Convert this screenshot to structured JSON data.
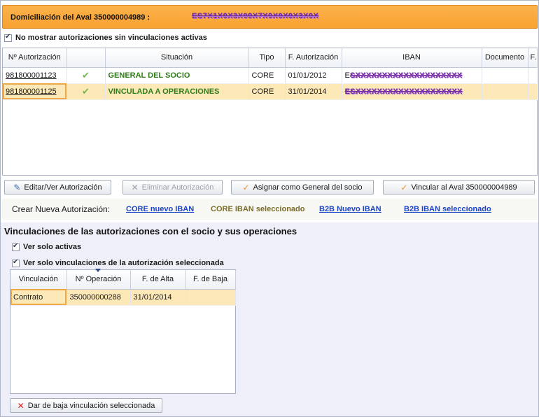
{
  "header": {
    "title": "Domiciliación del Aval 350000004989 :",
    "masked_value": "ES7X1X0X3X09X7X0X0X0X3X0X"
  },
  "filter_no_active": {
    "label": "No mostrar autorizaciones sin vinculaciones activas",
    "checked": true
  },
  "auth_table": {
    "columns": [
      "Nº Autorización",
      "",
      "Situación",
      "Tipo",
      "F. Autorización",
      "IBAN",
      "Documento",
      "F."
    ],
    "rows": [
      {
        "numero": "981800001123",
        "estado_icon": "check-icon",
        "situacion": "GENERAL DEL SOCIO",
        "tipo": "CORE",
        "fecha": "01/01/2012",
        "iban_prefix": "E",
        "iban_masked": "SXXXXXXXXXXXXXXXXXXXX",
        "documento": "",
        "extra": ""
      },
      {
        "numero": "981800001125",
        "estado_icon": "check-icon",
        "situacion": "VINCULADA A OPERACIONES",
        "tipo": "CORE",
        "fecha": "31/01/2014",
        "iban_prefix": "",
        "iban_masked": "ESXXXXXXXXXXXXXXXXXXXX",
        "documento": "",
        "extra": ""
      }
    ]
  },
  "toolbar": {
    "edit": "Editar/Ver Autorización",
    "delete": "Eliminar Autorización",
    "assign": "Asignar como General del socio",
    "link": "Vincular al Aval 350000004989"
  },
  "create": {
    "label": "Crear Nueva Autorización:",
    "core_new": "CORE nuevo IBAN",
    "core_selected": "CORE IBAN seleccionado",
    "b2b_new": "B2B Nuevo IBAN",
    "b2b_selected": "B2B IBAN seleccionado"
  },
  "links_section": {
    "title": "Vinculaciones de las autorizaciones con el socio y sus operaciones",
    "only_active": {
      "label": "Ver solo activas",
      "checked": true
    },
    "only_selected": {
      "label": "Ver  solo vinculaciones de la autorización seleccionada",
      "checked": true
    }
  },
  "links_table": {
    "columns": [
      "Vinculación",
      "Nº Operación",
      "F. de Alta",
      "F. de Baja"
    ],
    "rows": [
      {
        "vinculacion": "Contrato",
        "operacion": "350000000288",
        "alta": "31/01/2014",
        "baja": ""
      }
    ]
  },
  "unlink_button": "Dar de baja vinculación seleccionada",
  "colors": {
    "header_orange": "#f8a232",
    "selected_row": "#fde9b8",
    "link_blue": "#1a45c4",
    "status_green": "#2e7d1a"
  }
}
